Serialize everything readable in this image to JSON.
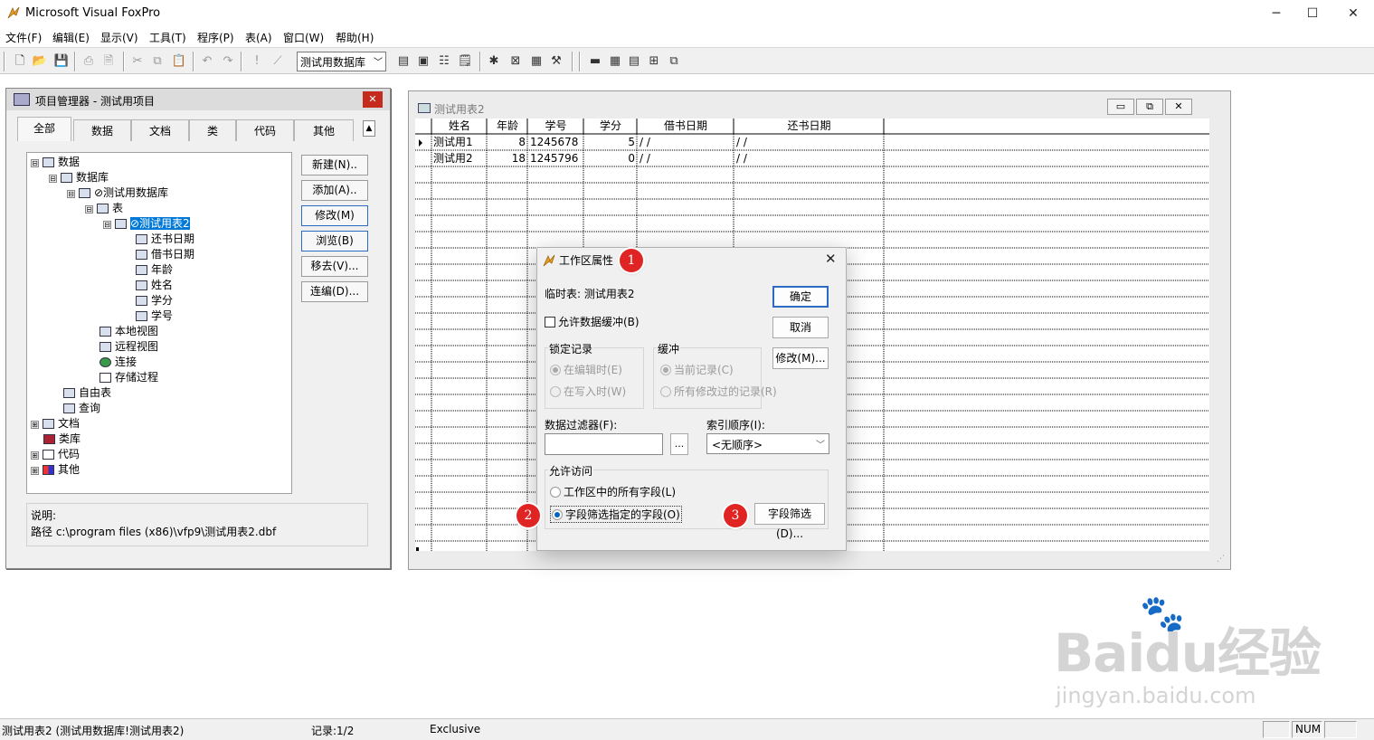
{
  "window": {
    "title": "Microsoft Visual FoxPro"
  },
  "menu": [
    "文件(F)",
    "编辑(E)",
    "显示(V)",
    "工具(T)",
    "程序(P)",
    "表(A)",
    "窗口(W)",
    "帮助(H)"
  ],
  "toolbar": {
    "database_combo": "测试用数据库"
  },
  "project_manager": {
    "title": "项目管理器 - 测试用项目",
    "tabs": [
      "全部",
      "数据",
      "文档",
      "类",
      "代码",
      "其他"
    ],
    "tree": [
      {
        "label": "数据",
        "expander": "⊟"
      },
      {
        "label": "数据库",
        "expander": "⊟"
      },
      {
        "label": "⊘测试用数据库",
        "expander": "⊟"
      },
      {
        "label": "表",
        "expander": "⊟"
      },
      {
        "label": "⊘测试用表2",
        "expander": "⊟"
      },
      {
        "label": "还书日期"
      },
      {
        "label": "借书日期"
      },
      {
        "label": "年龄"
      },
      {
        "label": "姓名"
      },
      {
        "label": "学分"
      },
      {
        "label": "学号"
      },
      {
        "label": "本地视图"
      },
      {
        "label": "远程视图"
      },
      {
        "label": "连接"
      },
      {
        "label": "存储过程"
      },
      {
        "label": "自由表"
      },
      {
        "label": "查询"
      },
      {
        "label": "文档",
        "expander": "⊞"
      },
      {
        "label": "类库"
      },
      {
        "label": "代码",
        "expander": "⊞"
      },
      {
        "label": "其他",
        "expander": "⊞"
      }
    ],
    "buttons": [
      "新建(N)..",
      "添加(A)..",
      "修改(M)",
      "浏览(B)",
      "移去(V)...",
      "连编(D)..."
    ],
    "description_label": "说明:",
    "description_path": "路径 c:\\program files (x86)\\vfp9\\测试用表2.dbf"
  },
  "browse": {
    "title": "测试用表2",
    "columns": [
      "姓名",
      "年龄",
      "学号",
      "学分",
      "借书日期",
      "还书日期"
    ],
    "rows": [
      [
        "测试用1",
        "8",
        "1245678",
        "5",
        "/ /",
        "/ /"
      ],
      [
        "测试用2",
        "18",
        "1245796",
        "0",
        "/ /",
        "/ /"
      ]
    ]
  },
  "dialog": {
    "title": "工作区属性",
    "temp_table": "临时表: 测试用表2",
    "allow_buffering": "允许数据缓冲(B)",
    "ok": "确定",
    "cancel": "取消",
    "modify": "修改(M)...",
    "lock_group": "锁定记录",
    "lock_edit": "在编辑时(E)",
    "lock_write": "在写入时(W)",
    "buffer_group": "缓冲",
    "buffer_current": "当前记录(C)",
    "buffer_all": "所有修改过的记录(R)",
    "filter_label": "数据过滤器(F):",
    "filter_value": "",
    "filter_button": "...",
    "order_label": "索引顺序(I):",
    "order_value": "<无顺序>",
    "access_group": "允许访问",
    "access_all": "工作区中的所有字段(L)",
    "access_filter": "字段筛选指定的字段(O)",
    "field_filter_button": "字段筛选(D)..."
  },
  "badges": [
    "1",
    "2",
    "3"
  ],
  "statusbar": {
    "table": "测试用表2 (测试用数据库!测试用表2)",
    "record": "记录:1/2",
    "mode": "Exclusive",
    "num": "NUM"
  },
  "watermark": {
    "logo": "Baidu经验",
    "url": "jingyan.baidu.com"
  },
  "colors": {
    "selection": "#0078d7",
    "close_red": "#c42b1c",
    "badge": "#e02424",
    "radio_on": "#0067c0"
  }
}
